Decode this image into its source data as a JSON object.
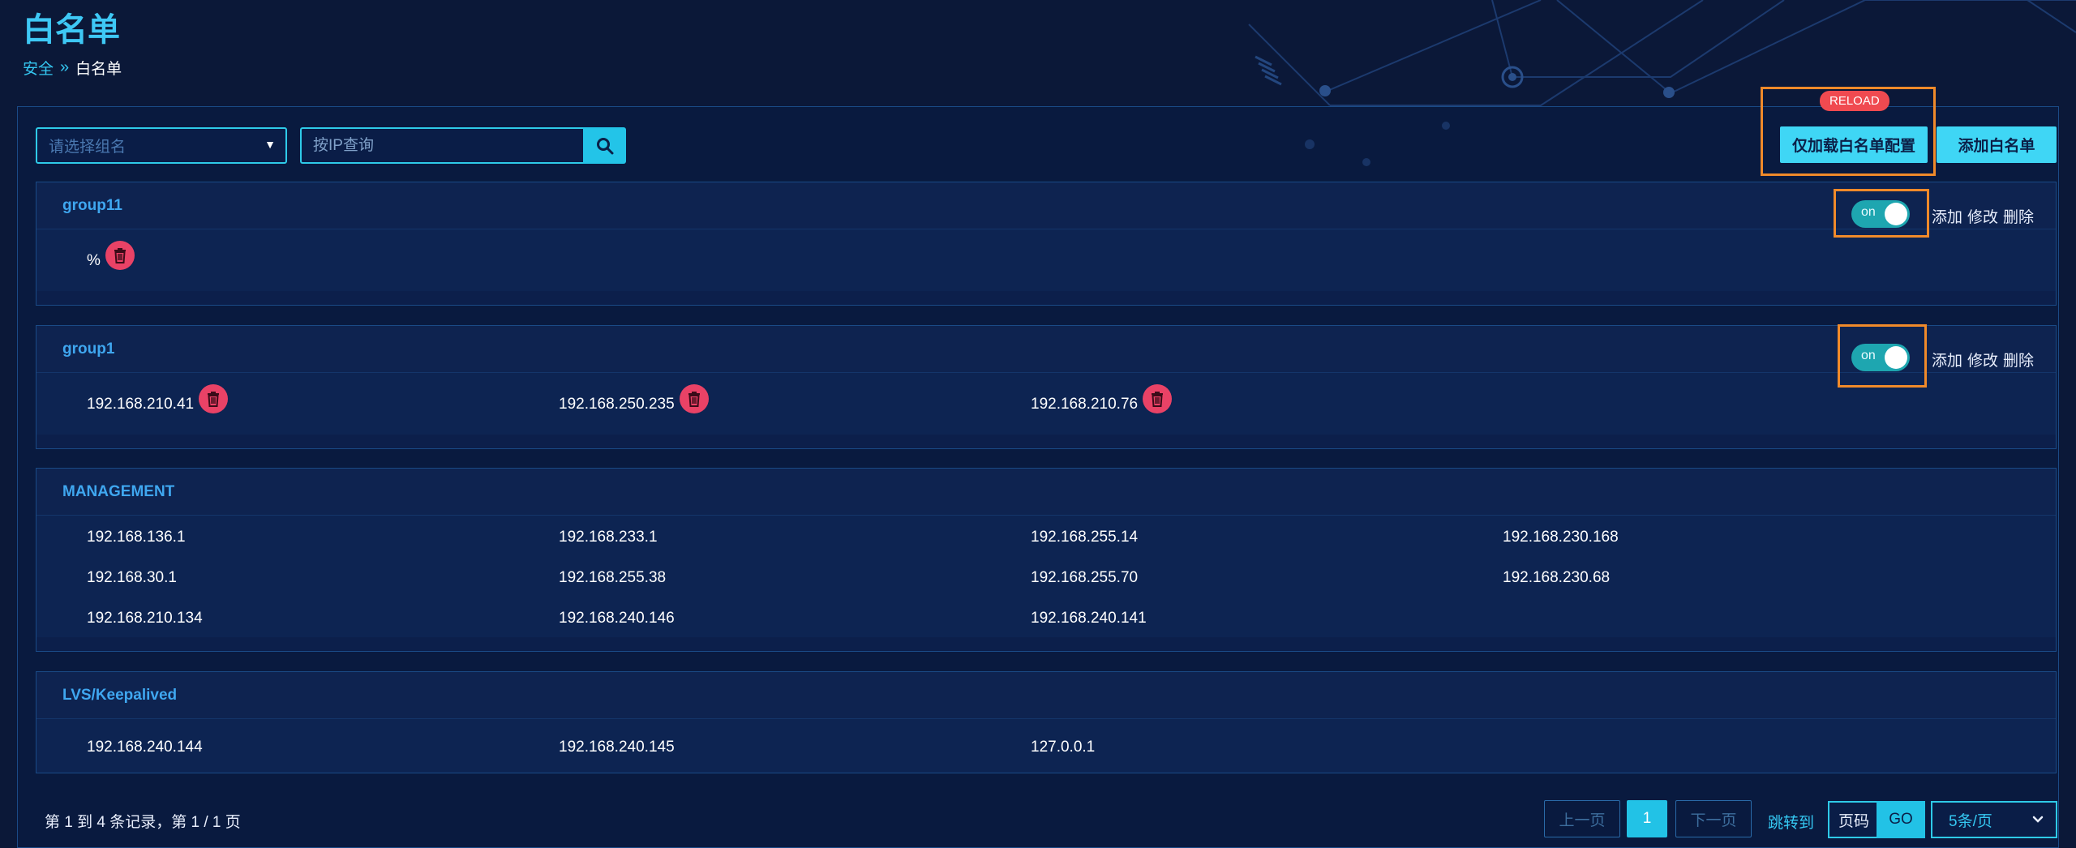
{
  "page": {
    "title": "白名单"
  },
  "breadcrumb": {
    "parent": "安全",
    "separator": "»",
    "current": "白名单"
  },
  "toolbar": {
    "group_select_placeholder": "请选择组名",
    "ip_search_placeholder": "按IP查询",
    "reload_badge": "RELOAD",
    "reload_button": "仅加载白名单配置",
    "add_button": "添加白名单"
  },
  "actions": {
    "add": "添加",
    "edit": "修改",
    "delete": "删除"
  },
  "groups": [
    {
      "name": "group11",
      "toggle": "on",
      "ips": [
        "%"
      ]
    },
    {
      "name": "group1",
      "toggle": "on",
      "ips": [
        "192.168.210.41",
        "192.168.250.235",
        "192.168.210.76"
      ]
    },
    {
      "name": "MANAGEMENT",
      "ips": [
        "192.168.136.1",
        "192.168.233.1",
        "192.168.255.14",
        "192.168.230.168",
        "192.168.30.1",
        "192.168.255.38",
        "192.168.255.70",
        "192.168.230.68",
        "192.168.210.134",
        "192.168.240.146",
        "192.168.240.141"
      ]
    },
    {
      "name": "LVS/Keepalived",
      "ips": [
        "192.168.240.144",
        "192.168.240.145",
        "127.0.0.1"
      ]
    }
  ],
  "footer": {
    "summary": "第 1 到 4 条记录，第 1 / 1 页",
    "prev": "上一页",
    "current_page": "1",
    "next": "下一页",
    "jump_to": "跳转到",
    "page_placeholder": "页码",
    "go": "GO",
    "page_size": "5条/页"
  },
  "colors": {
    "accent": "#3fd6f5",
    "highlight": "#f08a2a",
    "danger": "#e94266",
    "background": "#0b1838"
  }
}
